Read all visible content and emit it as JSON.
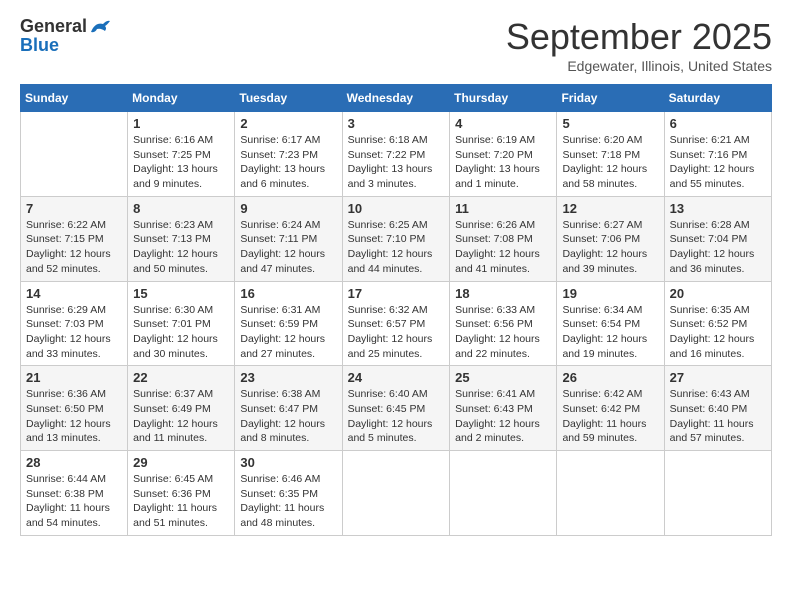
{
  "header": {
    "logo_general": "General",
    "logo_blue": "Blue",
    "month": "September 2025",
    "location": "Edgewater, Illinois, United States"
  },
  "days_of_week": [
    "Sunday",
    "Monday",
    "Tuesday",
    "Wednesday",
    "Thursday",
    "Friday",
    "Saturday"
  ],
  "weeks": [
    [
      {
        "day": "",
        "info": ""
      },
      {
        "day": "1",
        "info": "Sunrise: 6:16 AM\nSunset: 7:25 PM\nDaylight: 13 hours\nand 9 minutes."
      },
      {
        "day": "2",
        "info": "Sunrise: 6:17 AM\nSunset: 7:23 PM\nDaylight: 13 hours\nand 6 minutes."
      },
      {
        "day": "3",
        "info": "Sunrise: 6:18 AM\nSunset: 7:22 PM\nDaylight: 13 hours\nand 3 minutes."
      },
      {
        "day": "4",
        "info": "Sunrise: 6:19 AM\nSunset: 7:20 PM\nDaylight: 13 hours\nand 1 minute."
      },
      {
        "day": "5",
        "info": "Sunrise: 6:20 AM\nSunset: 7:18 PM\nDaylight: 12 hours\nand 58 minutes."
      },
      {
        "day": "6",
        "info": "Sunrise: 6:21 AM\nSunset: 7:16 PM\nDaylight: 12 hours\nand 55 minutes."
      }
    ],
    [
      {
        "day": "7",
        "info": "Sunrise: 6:22 AM\nSunset: 7:15 PM\nDaylight: 12 hours\nand 52 minutes."
      },
      {
        "day": "8",
        "info": "Sunrise: 6:23 AM\nSunset: 7:13 PM\nDaylight: 12 hours\nand 50 minutes."
      },
      {
        "day": "9",
        "info": "Sunrise: 6:24 AM\nSunset: 7:11 PM\nDaylight: 12 hours\nand 47 minutes."
      },
      {
        "day": "10",
        "info": "Sunrise: 6:25 AM\nSunset: 7:10 PM\nDaylight: 12 hours\nand 44 minutes."
      },
      {
        "day": "11",
        "info": "Sunrise: 6:26 AM\nSunset: 7:08 PM\nDaylight: 12 hours\nand 41 minutes."
      },
      {
        "day": "12",
        "info": "Sunrise: 6:27 AM\nSunset: 7:06 PM\nDaylight: 12 hours\nand 39 minutes."
      },
      {
        "day": "13",
        "info": "Sunrise: 6:28 AM\nSunset: 7:04 PM\nDaylight: 12 hours\nand 36 minutes."
      }
    ],
    [
      {
        "day": "14",
        "info": "Sunrise: 6:29 AM\nSunset: 7:03 PM\nDaylight: 12 hours\nand 33 minutes."
      },
      {
        "day": "15",
        "info": "Sunrise: 6:30 AM\nSunset: 7:01 PM\nDaylight: 12 hours\nand 30 minutes."
      },
      {
        "day": "16",
        "info": "Sunrise: 6:31 AM\nSunset: 6:59 PM\nDaylight: 12 hours\nand 27 minutes."
      },
      {
        "day": "17",
        "info": "Sunrise: 6:32 AM\nSunset: 6:57 PM\nDaylight: 12 hours\nand 25 minutes."
      },
      {
        "day": "18",
        "info": "Sunrise: 6:33 AM\nSunset: 6:56 PM\nDaylight: 12 hours\nand 22 minutes."
      },
      {
        "day": "19",
        "info": "Sunrise: 6:34 AM\nSunset: 6:54 PM\nDaylight: 12 hours\nand 19 minutes."
      },
      {
        "day": "20",
        "info": "Sunrise: 6:35 AM\nSunset: 6:52 PM\nDaylight: 12 hours\nand 16 minutes."
      }
    ],
    [
      {
        "day": "21",
        "info": "Sunrise: 6:36 AM\nSunset: 6:50 PM\nDaylight: 12 hours\nand 13 minutes."
      },
      {
        "day": "22",
        "info": "Sunrise: 6:37 AM\nSunset: 6:49 PM\nDaylight: 12 hours\nand 11 minutes."
      },
      {
        "day": "23",
        "info": "Sunrise: 6:38 AM\nSunset: 6:47 PM\nDaylight: 12 hours\nand 8 minutes."
      },
      {
        "day": "24",
        "info": "Sunrise: 6:40 AM\nSunset: 6:45 PM\nDaylight: 12 hours\nand 5 minutes."
      },
      {
        "day": "25",
        "info": "Sunrise: 6:41 AM\nSunset: 6:43 PM\nDaylight: 12 hours\nand 2 minutes."
      },
      {
        "day": "26",
        "info": "Sunrise: 6:42 AM\nSunset: 6:42 PM\nDaylight: 11 hours\nand 59 minutes."
      },
      {
        "day": "27",
        "info": "Sunrise: 6:43 AM\nSunset: 6:40 PM\nDaylight: 11 hours\nand 57 minutes."
      }
    ],
    [
      {
        "day": "28",
        "info": "Sunrise: 6:44 AM\nSunset: 6:38 PM\nDaylight: 11 hours\nand 54 minutes."
      },
      {
        "day": "29",
        "info": "Sunrise: 6:45 AM\nSunset: 6:36 PM\nDaylight: 11 hours\nand 51 minutes."
      },
      {
        "day": "30",
        "info": "Sunrise: 6:46 AM\nSunset: 6:35 PM\nDaylight: 11 hours\nand 48 minutes."
      },
      {
        "day": "",
        "info": ""
      },
      {
        "day": "",
        "info": ""
      },
      {
        "day": "",
        "info": ""
      },
      {
        "day": "",
        "info": ""
      }
    ]
  ]
}
